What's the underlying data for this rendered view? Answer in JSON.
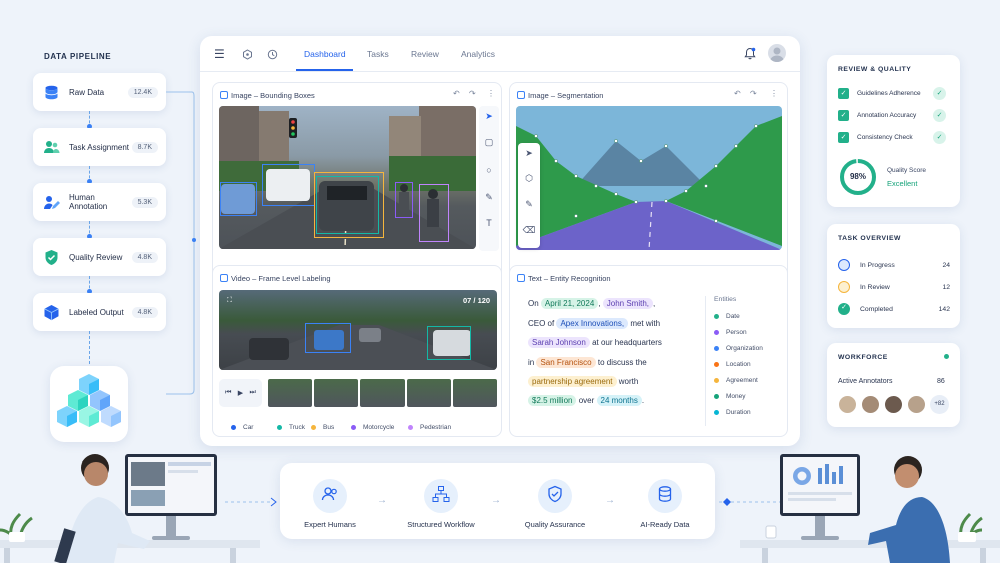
{
  "pipeline": {
    "title": "DATA PIPELINE",
    "steps": [
      {
        "label": "Raw Data",
        "count": "12.4K",
        "icon": "database-icon"
      },
      {
        "label": "Task Assignment",
        "count": "8.7K",
        "icon": "users-icon"
      },
      {
        "label": "Human Annotation",
        "count": "5.3K",
        "icon": "edit-user-icon"
      },
      {
        "label": "Quality Review",
        "count": "4.8K",
        "icon": "shield-check-icon"
      },
      {
        "label": "Labeled Output",
        "count": "4.8K",
        "icon": "cube-icon"
      }
    ]
  },
  "nav": {
    "tabs": [
      "Dashboard",
      "Tasks",
      "Review",
      "Analytics"
    ],
    "active": "Dashboard"
  },
  "panels": {
    "bbox": {
      "title": "Image – Bounding Boxes"
    },
    "seg": {
      "title": "Image – Segmentation"
    },
    "video": {
      "title": "Video – Frame Level Labeling",
      "frame_counter": "07 / 120"
    },
    "text": {
      "title": "Text – Entity Recognition",
      "sentence": {
        "w1": "On",
        "date": "April 21, 2024",
        "c1": ",",
        "person": "John Smith,",
        "c2": ",",
        "w2": "CEO of",
        "org": "Apex Innovations,",
        "w3": "met with",
        "person2": "Sarah Johnson",
        "w4": "at our headquarters",
        "w5": "in",
        "loc": "San Francisco",
        "w6": "to discuss the",
        "agree": "partnership agreement",
        "w7": "worth",
        "money": "$2.5 million",
        "w8": "over",
        "dur": "24 months",
        "w9": "."
      },
      "entities_title": "Entities",
      "entities": [
        {
          "label": "Date",
          "color": "#22b08a"
        },
        {
          "label": "Person",
          "color": "#8b5cf6"
        },
        {
          "label": "Organization",
          "color": "#3b82f6"
        },
        {
          "label": "Location",
          "color": "#f97316"
        },
        {
          "label": "Agreement",
          "color": "#f5b53d"
        },
        {
          "label": "Money",
          "color": "#16a37a"
        },
        {
          "label": "Duration",
          "color": "#06b6d4"
        }
      ]
    }
  },
  "video_legend": [
    {
      "label": "Car",
      "color": "#2563eb"
    },
    {
      "label": "Truck",
      "color": "#14b8a6"
    },
    {
      "label": "Bus",
      "color": "#f5b53d"
    },
    {
      "label": "Motorcycle",
      "color": "#8b5cf6"
    },
    {
      "label": "Pedestrian",
      "color": "#c084fc"
    }
  ],
  "review": {
    "title": "REVIEW & QUALITY",
    "checks": [
      "Guidelines Adherence",
      "Annotation Accuracy",
      "Consistency Check"
    ],
    "score_value": "98%",
    "score_fraction": 0.98,
    "score_label": "Quality Score",
    "score_status": "Excellent"
  },
  "tasks": {
    "title": "TASK OVERVIEW",
    "rows": [
      {
        "label": "In Progress",
        "value": "24",
        "color": "#2563eb"
      },
      {
        "label": "In Review",
        "value": "12",
        "color": "#f5b53d"
      },
      {
        "label": "Completed",
        "value": "142",
        "color": "#22b08a"
      }
    ]
  },
  "workforce": {
    "title": "WORKFORCE",
    "active_label": "Active Annotators",
    "active_value": "86",
    "more": "+82"
  },
  "bottom": [
    "Expert Humans",
    "Structured Workflow",
    "Quality Assurance",
    "AI-Ready Data"
  ],
  "colors": {
    "accent": "#2563eb",
    "success": "#22b08a"
  }
}
